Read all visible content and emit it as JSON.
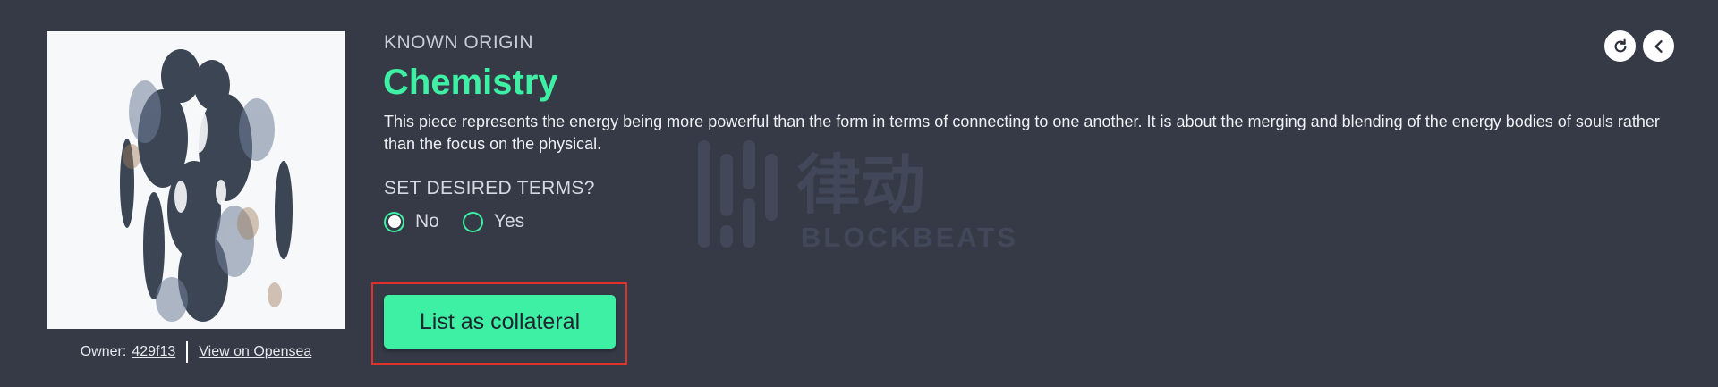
{
  "artwork": {
    "collection": "KNOWN ORIGIN",
    "title": "Chemistry",
    "description": "This piece represents the energy being more powerful than the form in terms of connecting to one another. It is about the merging and blending of the energy bodies of souls rather than the focus on the physical.",
    "image_icon": "artwork-image"
  },
  "owner": {
    "label": "Owner:",
    "address": "429f13",
    "opensea_link": "View on Opensea"
  },
  "terms": {
    "label": "SET DESIRED TERMS?",
    "options": [
      {
        "label": "No",
        "selected": true
      },
      {
        "label": "Yes",
        "selected": false
      }
    ]
  },
  "actions": {
    "list_button": "List as collateral",
    "refresh_icon": "refresh-icon",
    "back_icon": "chevron-left-icon"
  },
  "watermark": {
    "text": "BLOCKBEATS",
    "logo_text": "律动"
  },
  "colors": {
    "background": "#363a46",
    "accent": "#3ef0a4",
    "highlight": "#e0302a"
  }
}
